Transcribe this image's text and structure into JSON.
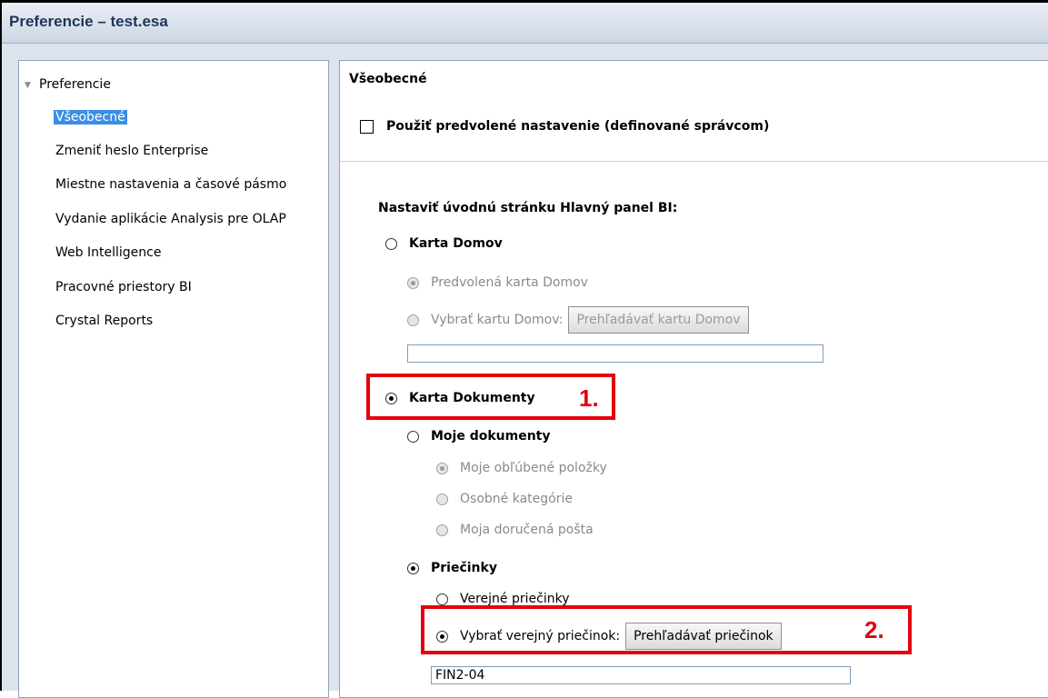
{
  "window": {
    "title": "Preferencie – test.esa"
  },
  "sidebar": {
    "root_label": "Preferencie",
    "items": [
      {
        "label": "Všeobecné",
        "selected": true
      },
      {
        "label": "Zmeniť heslo Enterprise"
      },
      {
        "label": "Miestne nastavenia a časové pásmo"
      },
      {
        "label": "Vydanie aplikácie Analysis pre OLAP"
      },
      {
        "label": "Web Intelligence"
      },
      {
        "label": "Pracovné priestory BI"
      },
      {
        "label": "Crystal Reports"
      }
    ]
  },
  "main": {
    "section_title": "Všeobecné",
    "use_default_label": "Použiť predvolené nastavenie (definované správcom)",
    "start_page_label": "Nastaviť úvodnú stránku Hlavný panel BI:",
    "home_tab_label": "Karta Domov",
    "default_home_label": "Predvolená karta Domov",
    "choose_home_label": "Vybrať kartu Domov:",
    "browse_home_button": "Prehľadávať kartu Domov",
    "home_field_value": "",
    "documents_tab_label": "Karta Dokumenty",
    "my_documents_label": "Moje dokumenty",
    "favorites_label": "Moje obľúbené položky",
    "personal_categories_label": "Osobné kategórie",
    "inbox_label": "Moja doručená pošta",
    "folders_label": "Priečinky",
    "public_folders_label": "Verejné priečinky",
    "choose_public_folder_label": "Vybrať verejný priečinok:",
    "browse_folder_button": "Prehľadávať priečinok",
    "folder_field_value": "FIN2-04"
  },
  "annotations": {
    "marker1": "1.",
    "marker2": "2.",
    "color": "#e3000f"
  }
}
